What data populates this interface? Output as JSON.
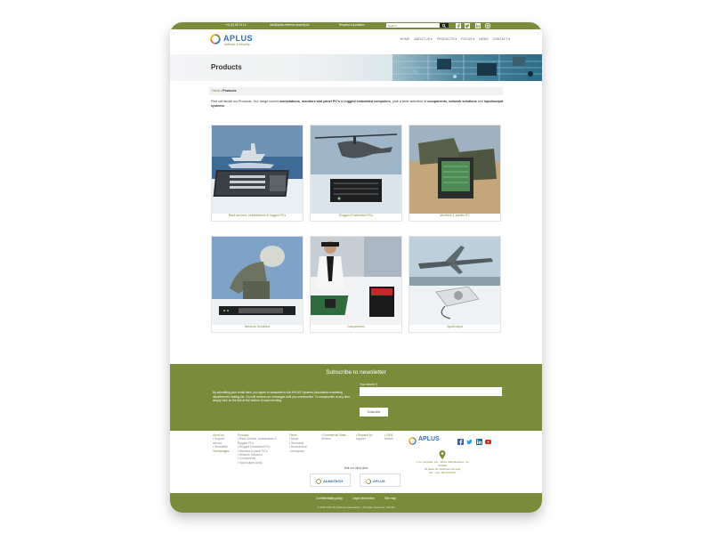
{
  "topbar": {
    "phone": "+41 (0) 86 74 15",
    "email": "info@aplus-defence-security.ch",
    "quotation": "Request a quotation",
    "search_placeholder": "Search"
  },
  "brand": {
    "name": "APLUS",
    "tagline": "defence & security",
    "color_accent": "#7a8c3a",
    "color_brand": "#2e6fb0"
  },
  "nav": {
    "items": [
      "HOME",
      "ABOUT US",
      "PRODUCTS",
      "FOCUS",
      "NEWS",
      "CONTACT"
    ]
  },
  "page": {
    "title": "Products"
  },
  "breadcrumb": {
    "home": "Home",
    "separator": " / ",
    "current": "Products"
  },
  "intro": {
    "p1": "Find out about our Products. Our range covers ",
    "b1": "workstations, monitors and panel PC's",
    "p2": " to ",
    "b2": "rugged embedded computers",
    "p3": ", plus a wide selection of ",
    "b3": "components, network solutions",
    "p4": " and ",
    "b4": "input/output systems",
    "p5": "."
  },
  "products": [
    {
      "label": "Rack servers, workstations & rugged PCs",
      "icon": "ship-server-image"
    },
    {
      "label": "Rugged Embedded PCs",
      "icon": "helicopter-embedded-image"
    },
    {
      "label": "Monitors & panels PC",
      "icon": "vehicle-monitor-image"
    },
    {
      "label": "Network Solutions",
      "icon": "radar-network-image"
    },
    {
      "label": "Components",
      "icon": "police-components-image"
    },
    {
      "label": "Input/output",
      "icon": "aircraft-io-image"
    }
  ],
  "newsletter": {
    "title": "Subscribe to newsletter",
    "text": "By submitting your email here, you agree to subscribe to the APLUS Systems Association marketing department's mailing list. You will receive our messages until you unsubscribe. To unsubscribe at any time, simply click on the link at the bottom of each sending.",
    "email_label": "Your email (*)",
    "button": "Subscribe"
  },
  "footer": {
    "col1": [
      "About us",
      "• Support",
      "service",
      "• Newsletter",
      "",
      "Technologies"
    ],
    "col2": [
      "Products",
      "• Rack Servers, workstations &",
      "Rugged PCs",
      "• Rugged Embedded PCs",
      "• Monitors & panel PC's",
      "• Network Solutions",
      "• Components",
      "• Input/output cards"
    ],
    "col3": [
      "Fields",
      "• Naval",
      "• Terrestrial",
      "• Aeronautical",
      "• Aerospace"
    ],
    "col4": [
      "• Commercial Sales",
      "Service"
    ],
    "col5": [
      "• Request for",
      "support"
    ],
    "col6": [
      "• OEM",
      "Market"
    ],
    "address": "7 rue Centrale, CH - Moirs Ville-Bussiere, Ch Vétabie",
    "address2": "18 place de l'audhnien de lage",
    "phone": "Tel : +41 / 86 00 00 00",
    "visit": "Visit our other sites",
    "sites": [
      "ALMATECH",
      "APLUS"
    ]
  },
  "bottombar": {
    "links": [
      "Confidentiality policy",
      "Legal information",
      "Site map"
    ],
    "copyright": "© 2022 APLUS Systems Association - All rights reserved. | PH ES"
  }
}
